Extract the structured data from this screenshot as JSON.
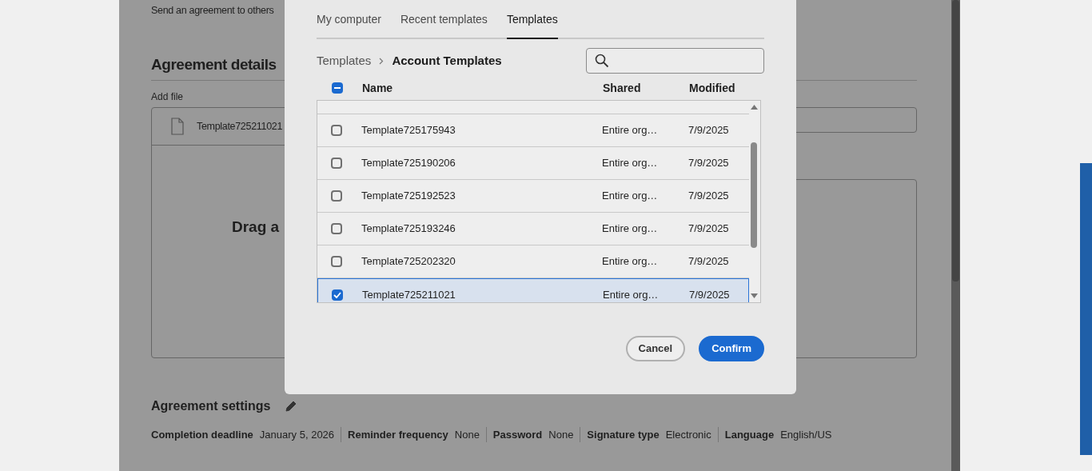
{
  "page": {
    "intro": "Send an agreement to others",
    "heading": "Agreement details",
    "add_file_label": "Add file",
    "file_name": "Template725211021",
    "drop_text": "Drag a",
    "settings_heading": "Agreement settings",
    "settings": [
      {
        "label": "Completion deadline",
        "value": "January 5, 2026"
      },
      {
        "label": "Reminder frequency",
        "value": "None"
      },
      {
        "label": "Password",
        "value": "None"
      },
      {
        "label": "Signature type",
        "value": "Electronic"
      },
      {
        "label": "Language",
        "value": "English/US"
      }
    ]
  },
  "dialog": {
    "tabs": [
      {
        "label": "My computer",
        "selected": false
      },
      {
        "label": "Recent templates",
        "selected": false
      },
      {
        "label": "Templates",
        "selected": true
      }
    ],
    "breadcrumb": [
      "Templates",
      "Account Templates"
    ],
    "select_all_indeterminate": true,
    "columns": [
      "Name",
      "Shared",
      "Modified"
    ],
    "rows": [
      {
        "name": "Template725175943",
        "shared": "Entire org…",
        "modified": "7/9/2025",
        "selected": false
      },
      {
        "name": "Template725190206",
        "shared": "Entire org…",
        "modified": "7/9/2025",
        "selected": false
      },
      {
        "name": "Template725192523",
        "shared": "Entire org…",
        "modified": "7/9/2025",
        "selected": false
      },
      {
        "name": "Template725193246",
        "shared": "Entire org…",
        "modified": "7/9/2025",
        "selected": false
      },
      {
        "name": "Template725202320",
        "shared": "Entire org…",
        "modified": "7/9/2025",
        "selected": false
      },
      {
        "name": "Template725211021",
        "shared": "Entire org…",
        "modified": "7/9/2025",
        "selected": true
      }
    ],
    "buttons": [
      {
        "label": "Cancel",
        "kind": "secondary"
      },
      {
        "label": "Confirm",
        "kind": "primary"
      }
    ]
  }
}
